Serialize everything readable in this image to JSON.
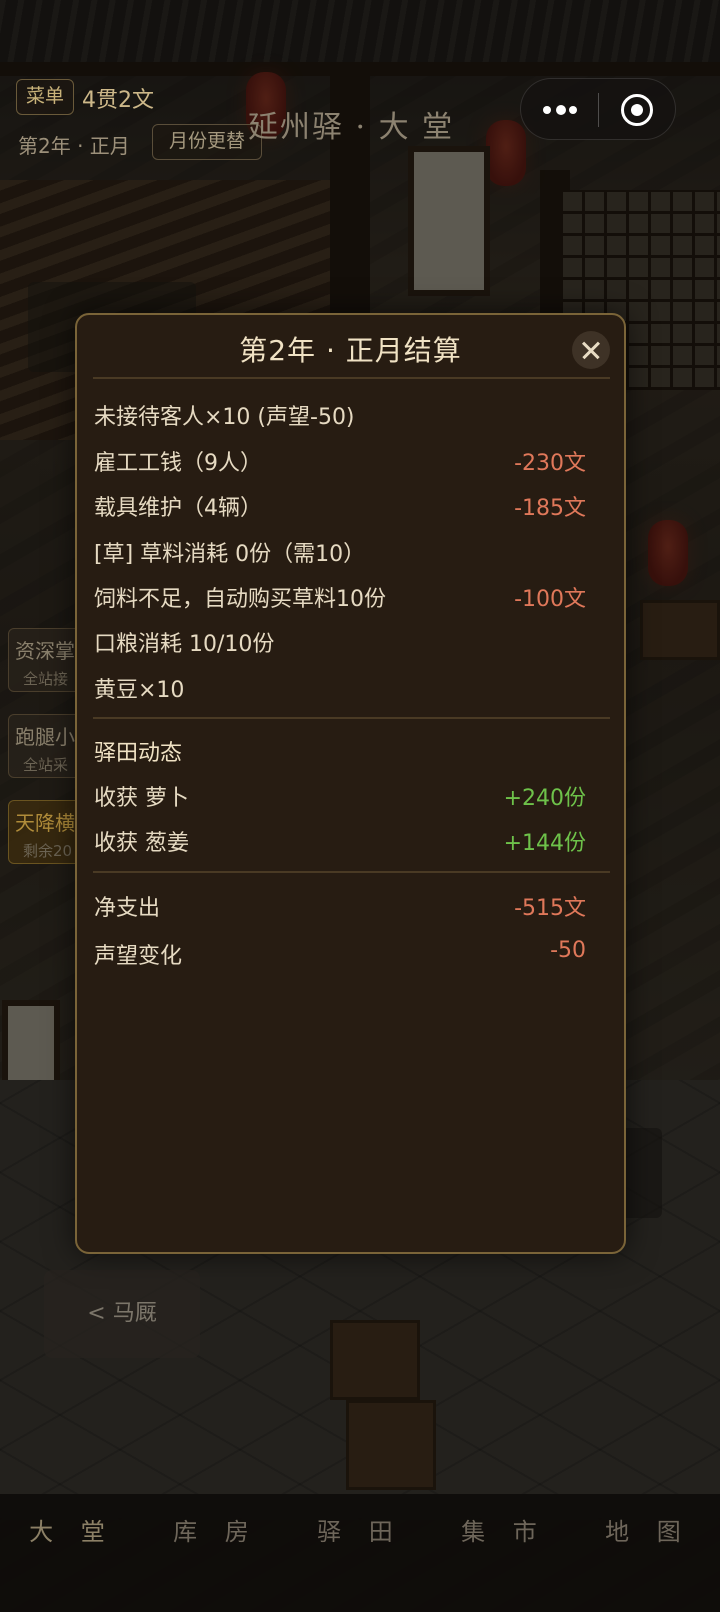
{
  "topbar": {
    "menu_label": "菜单",
    "money": "4贯2文",
    "date": "第2年 · 正月",
    "month_change_label": "月份更替",
    "page_title": "延州驿 · 大 堂"
  },
  "miniapp_capsule": {
    "more_icon": "more-dots-icon",
    "close_icon": "record-circle-icon"
  },
  "side_cards": [
    {
      "title": "资深掌",
      "sub": "全站接"
    },
    {
      "title": "跑腿小",
      "sub": "全站采"
    },
    {
      "title": "天降横",
      "sub": "剩余20"
    }
  ],
  "stable_button": "< 马厩",
  "bottom_nav": [
    {
      "label": "大 堂"
    },
    {
      "label": "库 房"
    },
    {
      "label": "驿 田"
    },
    {
      "label": "集 市"
    },
    {
      "label": "地 图"
    }
  ],
  "modal": {
    "title": "第2年 · 正月结算",
    "close_icon": "close-icon",
    "expenses": [
      {
        "label": "未接待客人×10 (声望-50)",
        "value": ""
      },
      {
        "label": "雇工工钱（9人）",
        "value": "-230文"
      },
      {
        "label": "载具维护（4辆）",
        "value": "-185文"
      },
      {
        "label": "[草] 草料消耗 0份（需10）",
        "value": ""
      },
      {
        "label": "饲料不足，自动购买草料10份",
        "value": "-100文"
      },
      {
        "label": "口粮消耗 10/10份",
        "value": ""
      },
      {
        "label": "黄豆×10",
        "value": ""
      }
    ],
    "farm_section_title": "驿田动态",
    "farm": [
      {
        "label": "收获 萝卜",
        "value": "+240份"
      },
      {
        "label": "收获 葱姜",
        "value": "+144份"
      }
    ],
    "summary": [
      {
        "label": "净支出",
        "value": "-515文"
      },
      {
        "label": "声望变化",
        "value": "-50"
      }
    ],
    "colors": {
      "negative": "#e0785a",
      "positive": "#6ec24a",
      "border": "#7a6438"
    }
  }
}
